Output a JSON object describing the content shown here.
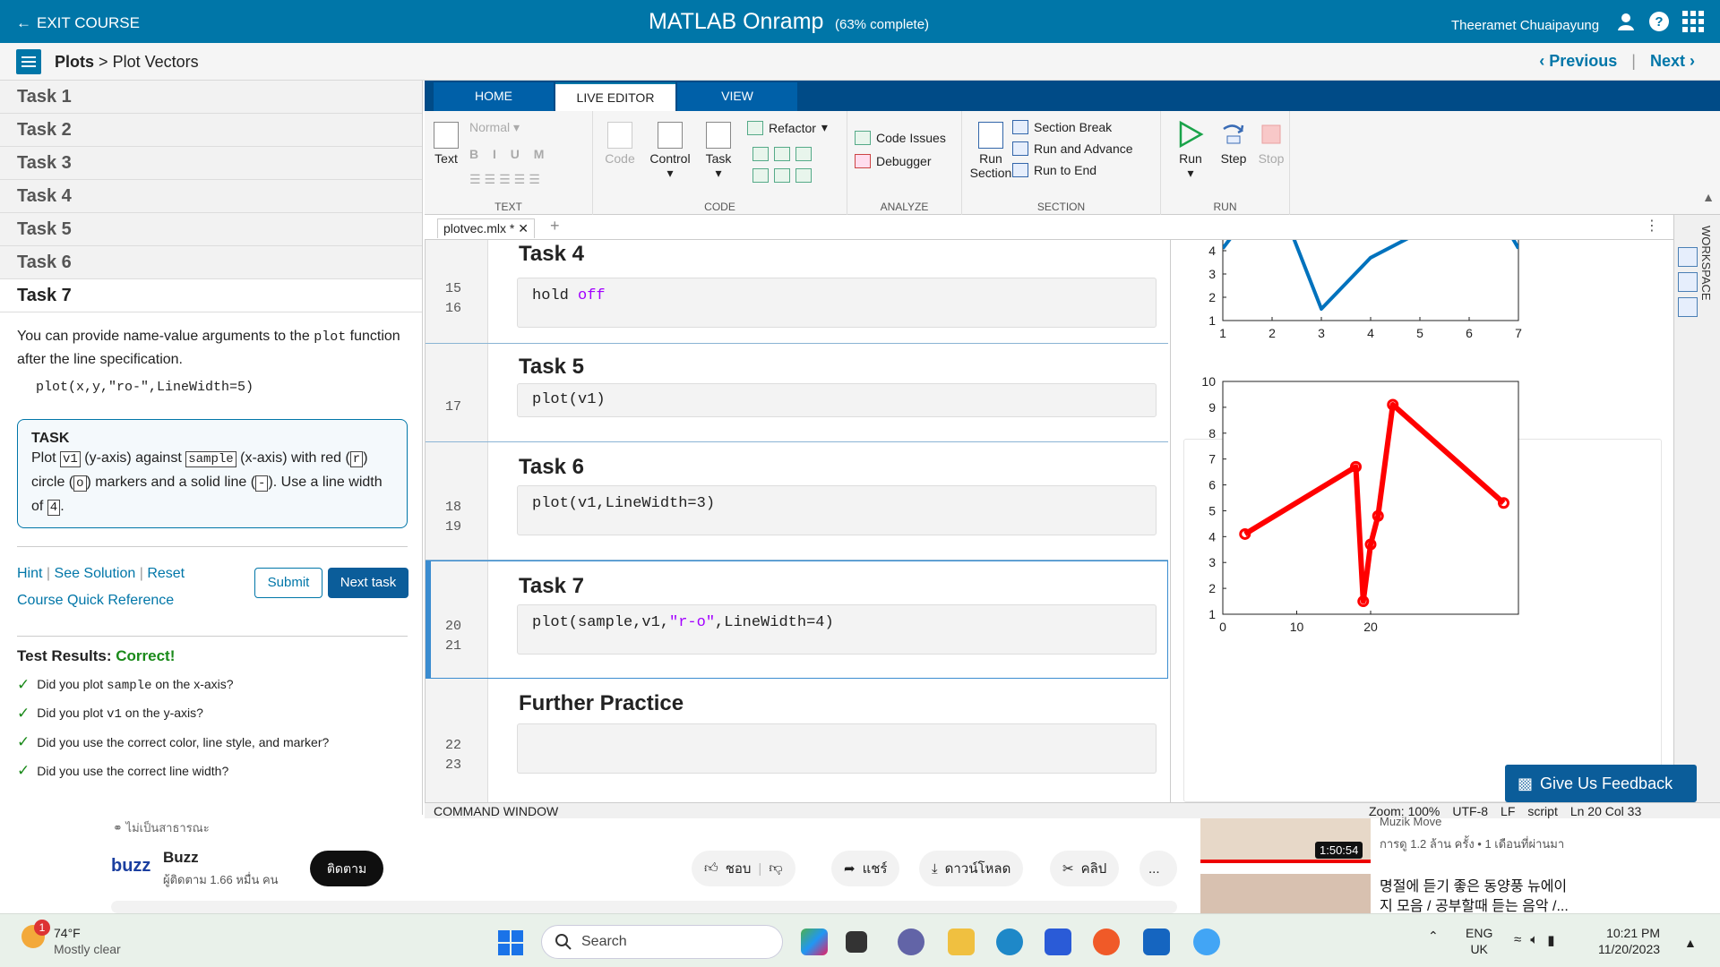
{
  "topbar": {
    "exit_label": "EXIT COURSE",
    "title": "MATLAB Onramp",
    "progress_text": "(63% complete)",
    "user": "Theeramet Chuaipayung"
  },
  "breadcrumb": {
    "section": "Plots",
    "separator": ">",
    "page": "Plot Vectors",
    "previous_label": "Previous",
    "next_label": "Next"
  },
  "left": {
    "tasks": [
      "Task 1",
      "Task 2",
      "Task 3",
      "Task 4",
      "Task 5",
      "Task 6",
      "Task 7"
    ],
    "description_a": "You can provide name-value arguments to the",
    "description_code": "plot",
    "description_b": "function after the line specification.",
    "example": "plot(x,y,\"ro-\",LineWidth=5)",
    "task_heading": "TASK",
    "task_text": {
      "p1": "Plot",
      "v1": "v1",
      "p2": "(y-axis) against",
      "sample": "sample",
      "p3": "(x-axis) with red (",
      "r": "r",
      "p4": ")",
      "p5": "circle (",
      "o": "o",
      "p6": ") markers and a solid line (",
      "dash": "-",
      "p7": "). Use a line",
      "p8": "width of",
      "four": "4",
      "p9": "."
    },
    "hint_label": "Hint",
    "solution_label": "See Solution",
    "reset_label": "Reset",
    "reference_label": "Course Quick Reference",
    "submit_label": "Submit",
    "next_task_label": "Next task",
    "results_label": "Test Results:",
    "results_status": "Correct!",
    "results": [
      {
        "a": "Did you plot",
        "code": "sample",
        "b": "on the x-axis?"
      },
      {
        "a": "Did you plot",
        "code": "v1",
        "b": "on the y-axis?"
      },
      {
        "a": "Did you use the correct color, line style, and marker?",
        "code": "",
        "b": ""
      },
      {
        "a": "Did you use the correct line width?",
        "code": "",
        "b": ""
      }
    ]
  },
  "toolstrip": {
    "tabs": [
      "HOME",
      "LIVE EDITOR",
      "VIEW"
    ],
    "active_tab": "LIVE EDITOR",
    "text_group": {
      "label": "TEXT",
      "text_btn": "Text",
      "style": "Normal"
    },
    "code_group": {
      "label": "CODE",
      "code": "Code",
      "control": "Control",
      "task": "Task",
      "refactor": "Refactor"
    },
    "analyze_group": {
      "label": "ANALYZE",
      "code_issues": "Code Issues",
      "debugger": "Debugger"
    },
    "section_group": {
      "label": "SECTION",
      "run_section": "Run Section",
      "section_break": "Section Break",
      "run_advance": "Run and Advance",
      "run_end": "Run to End"
    },
    "run_group": {
      "label": "RUN",
      "run": "Run",
      "step": "Step",
      "stop": "Stop"
    }
  },
  "file_tab": "plotvec.mlx *",
  "editor": {
    "sections": [
      {
        "title": "Task 4",
        "lines": [
          "15",
          "16"
        ],
        "code_kw": "hold",
        "code_arg": "off"
      },
      {
        "title": "Task 5",
        "lines": [
          "17"
        ],
        "code": "plot(v1)"
      },
      {
        "title": "Task 6",
        "lines": [
          "18",
          "19"
        ],
        "code": "plot(v1,LineWidth=3)"
      },
      {
        "title": "Task 7",
        "lines": [
          "20",
          "21"
        ],
        "code_a": "plot(sample,v1,",
        "code_str": "\"r-o\"",
        "code_b": ",LineWidth=4)"
      },
      {
        "title": "Further Practice",
        "lines": [
          "22",
          "23"
        ],
        "code": ""
      }
    ]
  },
  "workspace_label": "WORKSPACE",
  "status": {
    "command_window": "COMMAND WINDOW",
    "zoom": "Zoom: 100%",
    "encoding": "UTF-8",
    "eol": "LF",
    "mode": "script",
    "position": "Ln 20  Col 33"
  },
  "feedback_label": "Give Us Feedback",
  "chart_data": [
    {
      "type": "line",
      "color": "#0072bd",
      "x": [
        1,
        2,
        3,
        4,
        5,
        6,
        7
      ],
      "values": [
        4.1,
        6.9,
        1.5,
        3.7,
        4.8,
        7.8,
        4.1
      ],
      "xlim": [
        1,
        7
      ],
      "ylim": [
        1,
        5
      ],
      "xticks": [
        "1",
        "2",
        "3",
        "4",
        "5",
        "6",
        "7"
      ],
      "yticks": [
        "1",
        "2",
        "3",
        "4",
        "5"
      ]
    },
    {
      "type": "line",
      "color": "#ff0000",
      "x": [
        3,
        18,
        19,
        20,
        21,
        23,
        38
      ],
      "values": [
        4.1,
        6.7,
        1.5,
        3.7,
        4.8,
        9.1,
        5.3
      ],
      "xlim": [
        0,
        40
      ],
      "ylim": [
        1,
        10
      ],
      "xticks": [
        "0",
        "10",
        "20"
      ],
      "yticks": [
        "1",
        "2",
        "3",
        "4",
        "5",
        "6",
        "7",
        "8",
        "9",
        "10"
      ]
    }
  ],
  "youtube": {
    "public_label": "ไม่เป็นสาธารณะ",
    "logo": "buzz",
    "channel": "Buzz",
    "subscribers": "ผู้ติดตาม 1.66 หมื่น คน",
    "follow": "ติดตาม",
    "like": "ชอบ",
    "share": "แชร์",
    "download": "ดาวน์โหลด",
    "clip": "คลิป",
    "more": "...",
    "side1_channel": "Muzik Move",
    "side1_meta": "การดู 1.2 ล้าน ครั้ง  • 1 เดือนที่ผ่านมา",
    "side1_duration": "1:50:54",
    "side2_title1": "명절에 듣기 좋은 동양풍 뉴에이",
    "side2_title2": "지 모음 / 공부할때 듣는 음악 /..."
  },
  "taskbar": {
    "weather_badge": "1",
    "temperature": "74°F",
    "weather_desc": "Mostly clear",
    "search_placeholder": "Search",
    "lang1": "ENG",
    "lang2": "UK",
    "time": "10:21 PM",
    "date": "11/20/2023"
  }
}
